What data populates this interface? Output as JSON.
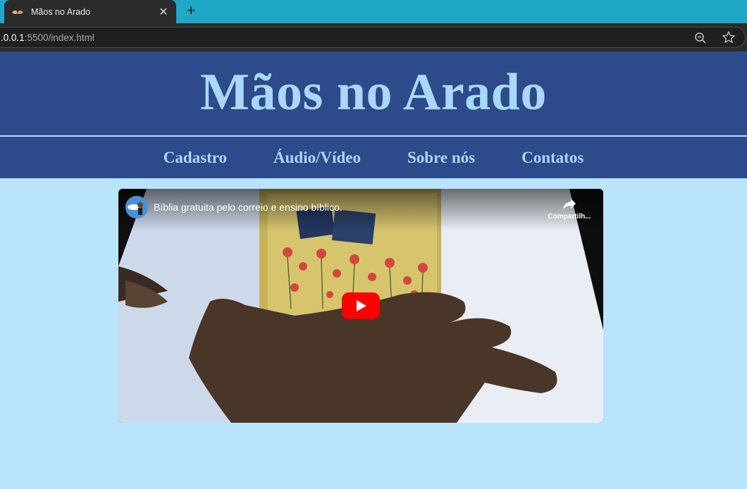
{
  "browser": {
    "tab_title": "Mãos no Arado",
    "close_glyph": "✕",
    "new_tab_glyph": "+",
    "url_host": ".0.0.1",
    "url_rest": ":5500/index.html",
    "icons": [
      "favicon-hands-icon",
      "close-icon",
      "plus-icon",
      "zoom-out-icon",
      "star-icon"
    ]
  },
  "header": {
    "title": "Mãos no Arado"
  },
  "nav": {
    "items": [
      {
        "label": "Cadastro"
      },
      {
        "label": "Áudio/Vídeo"
      },
      {
        "label": "Sobre nós"
      },
      {
        "label": "Contatos"
      }
    ]
  },
  "video": {
    "title": "Bíblia gratuita pelo correio e ensino bíblico.",
    "share_label": "Compartilh...",
    "icons": [
      "channel-avatar",
      "share-icon",
      "youtube-play-icon"
    ],
    "play_color": "#ff0000"
  },
  "colors": {
    "page_bg": "#b9e4fb",
    "header_bg": "#2d4a8a",
    "header_text": "#a8d8fb",
    "tabbar_bg": "#20a8c8"
  }
}
